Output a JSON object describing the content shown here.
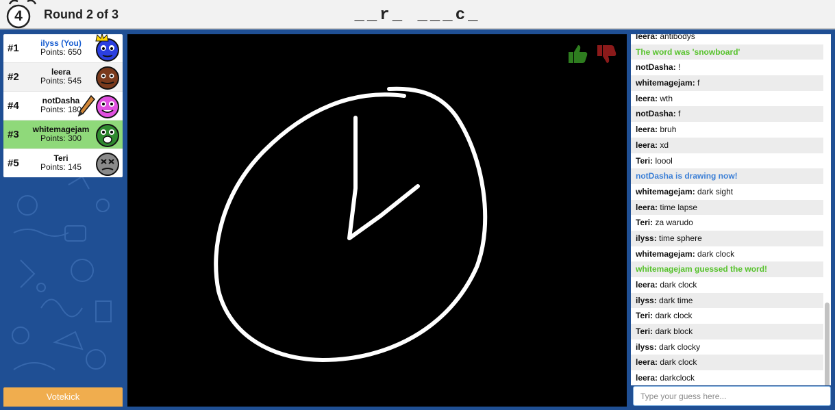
{
  "header": {
    "timer": "4",
    "round_label": "Round 2 of 3",
    "word_hint": "__r_ ___c_"
  },
  "players": [
    {
      "rank": "#1",
      "name": "ilyss (You)",
      "points": "Points: 650",
      "you": true,
      "avatar_color": "#2b3fe0",
      "crown": true
    },
    {
      "rank": "#2",
      "name": "leera",
      "points": "Points: 545",
      "avatar_color": "#7a3a1c"
    },
    {
      "rank": "#4",
      "name": "notDasha",
      "points": "Points: 180",
      "avatar_color": "#e050e0",
      "drawing": true
    },
    {
      "rank": "#3",
      "name": "whitemagejam",
      "points": "Points: 300",
      "avatar_color": "#2f8a2f",
      "guessed": true
    },
    {
      "rank": "#5",
      "name": "Teri",
      "points": "Points: 145",
      "avatar_color": "#8a8a8a"
    }
  ],
  "votekick_label": "Votekick",
  "chat": {
    "messages": [
      {
        "user": "leera",
        "text": "antibodys"
      },
      {
        "system": "The word was 'snowboard'",
        "color": "green"
      },
      {
        "user": "notDasha",
        "text": "!"
      },
      {
        "user": "whitemagejam",
        "text": "f"
      },
      {
        "user": "leera",
        "text": "wth"
      },
      {
        "user": "notDasha",
        "text": "f"
      },
      {
        "user": "leera",
        "text": "bruh"
      },
      {
        "user": "leera",
        "text": "xd"
      },
      {
        "user": "Teri",
        "text": "loool"
      },
      {
        "system": "notDasha is drawing now!",
        "color": "blue"
      },
      {
        "user": "whitemagejam",
        "text": "dark sight"
      },
      {
        "user": "leera",
        "text": "time lapse"
      },
      {
        "user": "Teri",
        "text": "za warudo"
      },
      {
        "user": "ilyss",
        "text": "time sphere"
      },
      {
        "user": "whitemagejam",
        "text": "dark clock"
      },
      {
        "system": "whitemagejam guessed the word!",
        "color": "green"
      },
      {
        "user": "leera",
        "text": "dark clock"
      },
      {
        "user": "ilyss",
        "text": "dark time"
      },
      {
        "user": "Teri",
        "text": "dark clock"
      },
      {
        "user": "Teri",
        "text": "dark block"
      },
      {
        "user": "ilyss",
        "text": "dark clocky"
      },
      {
        "user": "leera",
        "text": "dark clock"
      },
      {
        "user": "leera",
        "text": "darkclock"
      }
    ],
    "input_placeholder": "Type your guess here..."
  },
  "colors": {
    "background": "#1f4f94",
    "guessed_row": "#8fd97a",
    "votekick": "#f0ad4e",
    "system_green": "#56c22b",
    "system_blue": "#3b7fd6",
    "thumb_up": "#2e7d1f",
    "thumb_down": "#8b1a1a"
  }
}
